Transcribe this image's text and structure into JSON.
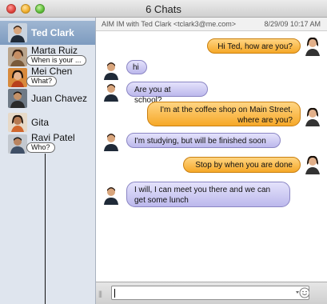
{
  "window": {
    "title": "6 Chats"
  },
  "sidebar": {
    "contacts": [
      {
        "name": "Ted Clark",
        "status": ""
      },
      {
        "name": "Marta Ruiz",
        "status": "When is your ..."
      },
      {
        "name": "Mei Chen",
        "status": "What?"
      },
      {
        "name": "Juan Chavez",
        "status": ""
      },
      {
        "name": "Gita",
        "status": ""
      },
      {
        "name": "Ravi Patel",
        "status": "Who?"
      }
    ]
  },
  "chat": {
    "header_with": "AIM IM with Ted Clark <tclark3@me.com>",
    "header_date": "8/29/09 10:17 AM",
    "messages": [
      {
        "direction": "out",
        "text": "Hi Ted, how are you?"
      },
      {
        "direction": "in",
        "text": "hi"
      },
      {
        "direction": "in",
        "text": "Are you at school?"
      },
      {
        "direction": "out",
        "text": "I'm at the coffee shop on Main Street, where are you?"
      },
      {
        "direction": "in",
        "text": "I'm studying, but will be finished soon"
      },
      {
        "direction": "out",
        "text": "Stop by when you are done"
      },
      {
        "direction": "in",
        "text": "I will, I can meet you there and we can get some lunch"
      }
    ]
  },
  "input": {
    "value": "",
    "placeholder": ""
  },
  "colors": {
    "incoming_bubble": "#c8c5f0",
    "outgoing_bubble": "#f8b53c",
    "selected_contact": "#8aa6c8",
    "sidebar_bg": "#dfe5ee"
  },
  "icons": [
    "close-icon",
    "minimize-icon",
    "zoom-icon",
    "emoticon-icon",
    "resize-grip-icon"
  ]
}
